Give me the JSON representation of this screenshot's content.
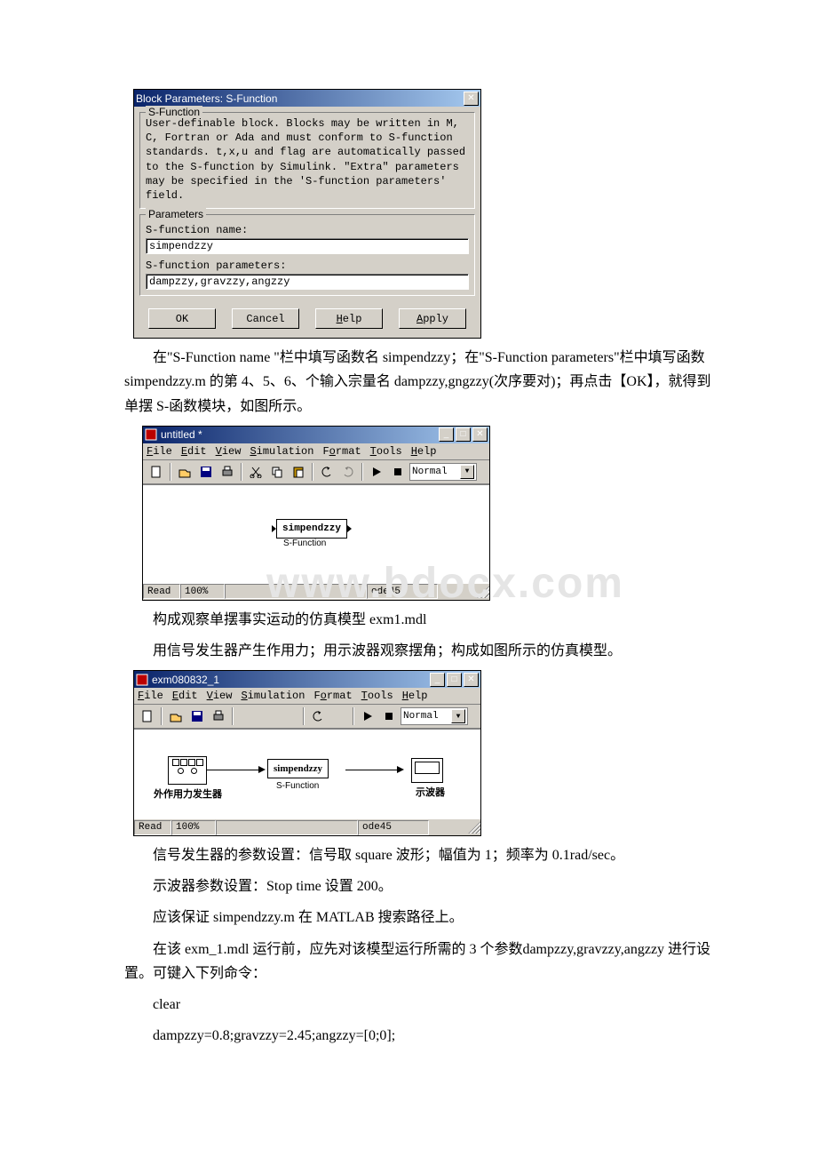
{
  "dialog": {
    "title": "Block Parameters: S-Function",
    "group1": {
      "legend": "S-Function",
      "desc": "User-definable block.  Blocks may be written in M, C, Fortran or Ada and must  conform to S-function standards. t,x,u and flag are automatically passed to the S-function by Simulink.  \"Extra\" parameters may be specified in the 'S-function parameters' field."
    },
    "group2": {
      "legend": "Parameters",
      "name_label": "S-function name:",
      "name_value": "simpendzzy",
      "params_label": "S-function parameters:",
      "params_value": "dampzzy,gravzzy,angzzy"
    },
    "buttons": {
      "ok": "OK",
      "cancel": "Cancel",
      "help": "Help",
      "apply": "Apply"
    }
  },
  "para1": "在\"S-Function name \"栏中填写函数名 simpendzzy；在\"S-Function parameters\"栏中填写函数 simpendzzy.m 的第 4、5、6、个输入宗量名 dampzzy,gngzzy(次序要对)；再点击【OK】，就得到单摆 S-函数模块，如图所示。",
  "win1": {
    "title": "untitled *",
    "menus": [
      "File",
      "Edit",
      "View",
      "Simulation",
      "Format",
      "Tools",
      "Help"
    ],
    "mode": "Normal",
    "block_text": "simpendzzy",
    "block_label": "S-Function",
    "status_ready": "Read",
    "status_zoom": "100%",
    "status_solver": "ode45"
  },
  "watermark": "www.bdocx.com",
  "para2": "构成观察单摆事实运动的仿真模型 exm1.mdl",
  "para3": "用信号发生器产生作用力；用示波器观察摆角；构成如图所示的仿真模型。",
  "win2": {
    "title": "exm080832_1",
    "menus": [
      "File",
      "Edit",
      "View",
      "Simulation",
      "Format",
      "Tools",
      "Help"
    ],
    "mode": "Normal",
    "gen_label": "外作用力发生器",
    "block_text": "simpendzzy",
    "block_label": "S-Function",
    "scope_label": "示波器",
    "status_ready": "Read",
    "status_zoom": "100%",
    "status_solver": "ode45"
  },
  "para4": "信号发生器的参数设置：信号取 square 波形；幅值为 1；频率为 0.1rad/sec。",
  "para5": "示波器参数设置：Stop time 设置 200。",
  "para6": "应该保证 simpendzzy.m 在 MATLAB 搜索路径上。",
  "para7": "在该 exm_1.mdl 运行前，应先对该模型运行所需的 3 个参数dampzzy,gravzzy,angzzy 进行设置。可键入下列命令：",
  "para8": "clear",
  "para9": "dampzzy=0.8;gravzzy=2.45;angzzy=[0;0];"
}
